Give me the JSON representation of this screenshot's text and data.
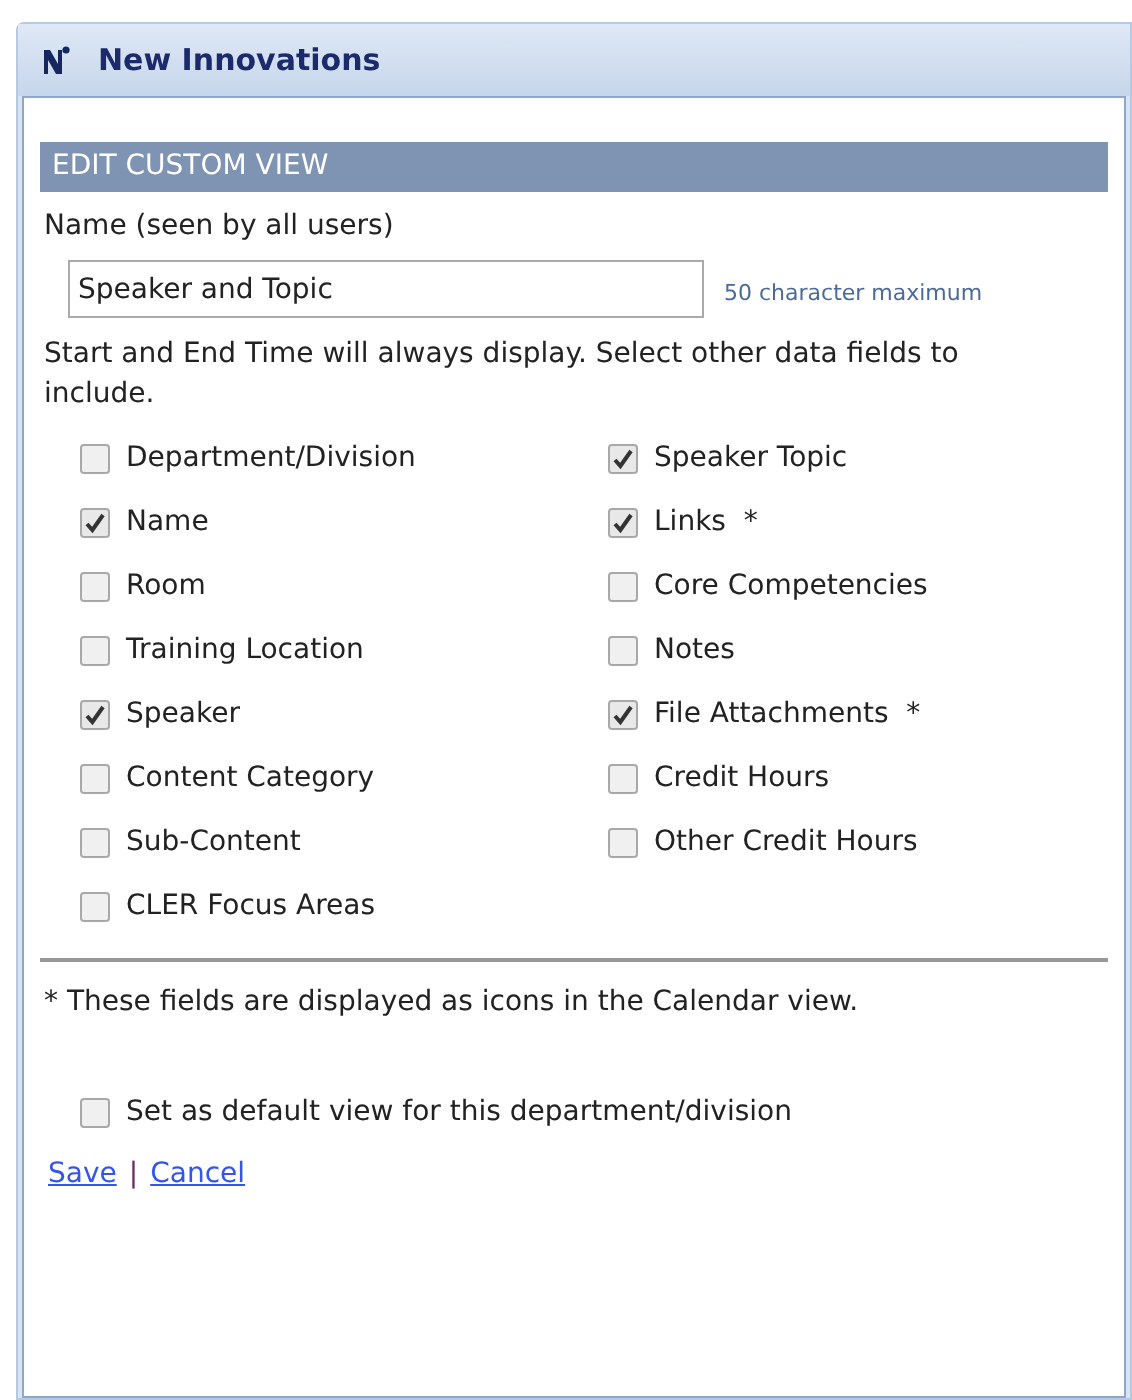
{
  "window": {
    "title": "New Innovations"
  },
  "panel": {
    "heading": "EDIT CUSTOM VIEW",
    "name_label": "Name (seen by all users)",
    "name_field": {
      "value": "Speaker and Topic"
    },
    "name_hint": "50 character maximum",
    "instructions": "Start and End Time will always display. Select other data fields to include.",
    "field_columns": [
      [
        {
          "label": "Department/Division",
          "checked": false
        },
        {
          "label": "Name",
          "checked": true
        },
        {
          "label": "Room",
          "checked": false
        },
        {
          "label": "Training Location",
          "checked": false
        },
        {
          "label": "Speaker",
          "checked": true
        },
        {
          "label": "Content Category",
          "checked": false
        },
        {
          "label": "Sub-Content",
          "checked": false
        },
        {
          "label": "CLER Focus Areas",
          "checked": false
        }
      ],
      [
        {
          "label": "Speaker Topic",
          "checked": true
        },
        {
          "label": "Links  *",
          "checked": true
        },
        {
          "label": "Core Competencies",
          "checked": false
        },
        {
          "label": "Notes",
          "checked": false
        },
        {
          "label": "File Attachments  *",
          "checked": true
        },
        {
          "label": "Credit Hours",
          "checked": false
        },
        {
          "label": "Other Credit Hours",
          "checked": false
        }
      ]
    ],
    "footnote": "* These fields are displayed as icons in the Calendar view.",
    "default_view": {
      "label": "Set as default view for this department/division",
      "checked": false
    },
    "links": [
      {
        "label": "Save"
      },
      {
        "label": "Cancel"
      }
    ],
    "link_separator": "|"
  }
}
